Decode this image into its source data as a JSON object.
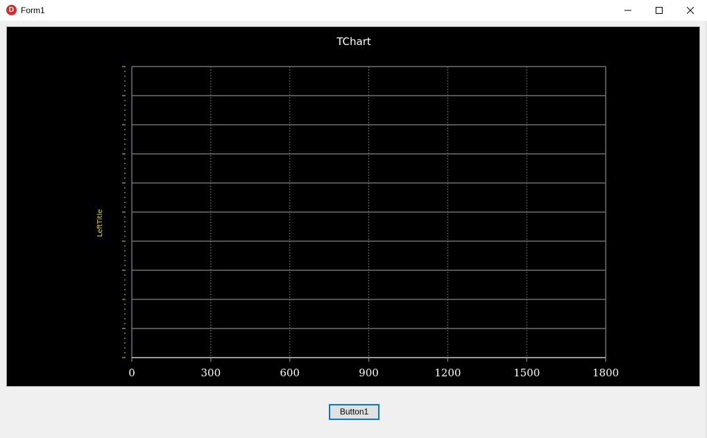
{
  "window": {
    "title": "Form1",
    "icon": "delphi-app-icon",
    "icon_glyph": "D",
    "controls": [
      "minimize",
      "maximize",
      "close"
    ]
  },
  "chart_data": {
    "type": "line",
    "title": "TChart",
    "xlabel": "",
    "ylabel": "LeftTitle",
    "x_ticks": [
      "0",
      "300",
      "600",
      "900",
      "1200",
      "1500",
      "1800"
    ],
    "xlim": [
      0,
      1800
    ],
    "series": [],
    "grid": true,
    "background": "#000000",
    "title_color": "#ffffff",
    "left_title_color": "#e8d800",
    "grid_color": "#707070",
    "tick_label_color": "#ffffff"
  },
  "button1": {
    "label": "Button1"
  }
}
